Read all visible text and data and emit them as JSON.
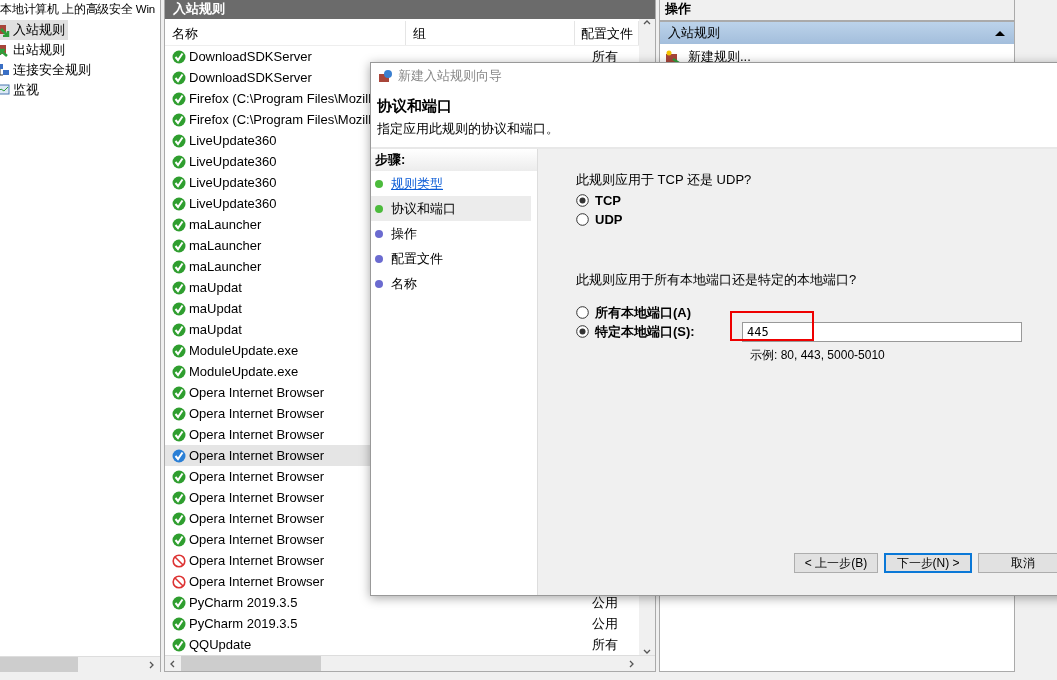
{
  "tree": {
    "title": "本地计算机 上的高级安全 Win",
    "items": [
      {
        "label": "入站规则",
        "selected": true,
        "kind": "inbound"
      },
      {
        "label": "出站规则",
        "selected": false,
        "kind": "outbound"
      },
      {
        "label": "连接安全规则",
        "selected": false,
        "kind": "security"
      },
      {
        "label": "监视",
        "selected": false,
        "kind": "monitor"
      }
    ]
  },
  "rules_pane": {
    "title": "入站规则",
    "columns": [
      "名称",
      "组",
      "配置文件"
    ],
    "rows": [
      {
        "name": "DownloadSDKServer",
        "kind": "allow",
        "selected": false,
        "profile": "所有"
      },
      {
        "name": "DownloadSDKServer",
        "kind": "allow",
        "selected": false
      },
      {
        "name": "Firefox (C:\\Program Files\\Mozill",
        "kind": "allow",
        "selected": false
      },
      {
        "name": "Firefox (C:\\Program Files\\Mozill",
        "kind": "allow",
        "selected": false
      },
      {
        "name": "LiveUpdate360",
        "kind": "allow",
        "selected": false
      },
      {
        "name": "LiveUpdate360",
        "kind": "allow",
        "selected": false
      },
      {
        "name": "LiveUpdate360",
        "kind": "allow",
        "selected": false
      },
      {
        "name": "LiveUpdate360",
        "kind": "allow",
        "selected": false
      },
      {
        "name": "maLauncher",
        "kind": "allow",
        "selected": false
      },
      {
        "name": "maLauncher",
        "kind": "allow",
        "selected": false
      },
      {
        "name": "maLauncher",
        "kind": "allow",
        "selected": false
      },
      {
        "name": "maUpdat",
        "kind": "allow",
        "selected": false
      },
      {
        "name": "maUpdat",
        "kind": "allow",
        "selected": false
      },
      {
        "name": "maUpdat",
        "kind": "allow",
        "selected": false
      },
      {
        "name": "ModuleUpdate.exe",
        "kind": "allow",
        "selected": false
      },
      {
        "name": "ModuleUpdate.exe",
        "kind": "allow",
        "selected": false
      },
      {
        "name": "Opera Internet Browser",
        "kind": "allow",
        "selected": false
      },
      {
        "name": "Opera Internet Browser",
        "kind": "allow",
        "selected": false
      },
      {
        "name": "Opera Internet Browser",
        "kind": "allow",
        "selected": false
      },
      {
        "name": "Opera Internet Browser",
        "kind": "allow",
        "selected": true
      },
      {
        "name": "Opera Internet Browser",
        "kind": "allow",
        "selected": false
      },
      {
        "name": "Opera Internet Browser",
        "kind": "allow",
        "selected": false
      },
      {
        "name": "Opera Internet Browser",
        "kind": "allow",
        "selected": false
      },
      {
        "name": "Opera Internet Browser",
        "kind": "allow",
        "selected": false
      },
      {
        "name": "Opera Internet Browser",
        "kind": "block",
        "selected": false
      },
      {
        "name": "Opera Internet Browser",
        "kind": "block",
        "selected": false
      },
      {
        "name": "PyCharm 2019.3.5",
        "kind": "allow",
        "selected": false,
        "profile": "公用"
      },
      {
        "name": "PyCharm 2019.3.5",
        "kind": "allow",
        "selected": false,
        "profile": "公用"
      },
      {
        "name": "QQUpdate",
        "kind": "allow",
        "selected": false,
        "profile": "所有"
      }
    ]
  },
  "actions_pane": {
    "title": "操作",
    "section": {
      "title": "入站规则",
      "expanded": true
    },
    "items": [
      "新建规则..."
    ]
  },
  "dialog": {
    "title": "新建入站规则向导",
    "heading": "协议和端口",
    "subtitle": "指定应用此规则的协议和端口。",
    "steps_title": "步骤:",
    "steps": [
      {
        "label": "规则类型",
        "done": true,
        "selected": false
      },
      {
        "label": "协议和端口",
        "done": true,
        "selected": true
      },
      {
        "label": "操作",
        "done": false,
        "selected": false
      },
      {
        "label": "配置文件",
        "done": false,
        "selected": false
      },
      {
        "label": "名称",
        "done": false,
        "selected": false
      }
    ],
    "protocol_question": "此规则应用于 TCP 还是 UDP?",
    "protocols": [
      {
        "label": "TCP",
        "selected": true
      },
      {
        "label": "UDP",
        "selected": false
      }
    ],
    "port_question": "此规则应用于所有本地端口还是特定的本地端口?",
    "port_options": [
      {
        "label": "所有本地端口(A)",
        "selected": false
      },
      {
        "label": "特定本地端口(S):",
        "selected": true
      }
    ],
    "port_value": "445",
    "port_hint": "示例: 80, 443, 5000-5010",
    "buttons": [
      {
        "label": "< 上一步(B)",
        "default": false
      },
      {
        "label": "下一步(N) >",
        "default": true
      },
      {
        "label": "取消",
        "default": false
      }
    ]
  }
}
